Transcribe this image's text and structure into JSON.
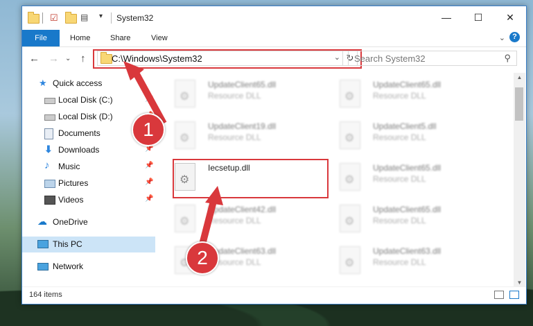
{
  "window": {
    "title": "System32",
    "controls": {
      "minimize": "—",
      "maximize": "☐",
      "close": "✕"
    }
  },
  "ribbon": {
    "tabs": [
      "File",
      "Home",
      "Share",
      "View"
    ],
    "expand_glyph": "⌄",
    "help_glyph": "?"
  },
  "nav": {
    "back": "←",
    "forward": "→",
    "recent": "⌄",
    "up": "↑",
    "address": "C:\\Windows\\System32",
    "address_dropdown": "⌄",
    "refresh": "↻",
    "search_placeholder": "Search System32",
    "search_icon": "⚲"
  },
  "sidebar": {
    "items": [
      {
        "label": "Quick access",
        "icon": "star-icon",
        "pinned": false
      },
      {
        "label": "Local Disk (C:)",
        "icon": "drive-icon",
        "pinned": true
      },
      {
        "label": "Local Disk (D:)",
        "icon": "drive-icon",
        "pinned": true
      },
      {
        "label": "Documents",
        "icon": "documents-icon",
        "pinned": true
      },
      {
        "label": "Downloads",
        "icon": "download-icon",
        "pinned": true
      },
      {
        "label": "Music",
        "icon": "music-icon",
        "pinned": true
      },
      {
        "label": "Pictures",
        "icon": "pictures-icon",
        "pinned": true
      },
      {
        "label": "Videos",
        "icon": "videos-icon",
        "pinned": true
      },
      {
        "label": "OneDrive",
        "icon": "cloud-icon",
        "pinned": false
      },
      {
        "label": "This PC",
        "icon": "pc-icon",
        "pinned": false,
        "selected": true
      },
      {
        "label": "Network",
        "icon": "network-icon",
        "pinned": false
      }
    ],
    "pin_glyph": "📌"
  },
  "files": [
    {
      "name": "UpdateClient65.dll",
      "type": "Resource DLL",
      "blurred": true
    },
    {
      "name": "UpdateClient65.dll",
      "type": "Resource DLL",
      "blurred": true
    },
    {
      "name": "UpdateClient19.dll",
      "type": "Resource DLL",
      "blurred": true
    },
    {
      "name": "UpdateClient5.dll",
      "type": "Resource DLL",
      "blurred": true
    },
    {
      "name": "Iecsetup.dll",
      "type": "",
      "blurred": false
    },
    {
      "name": "UpdateClient65.dll",
      "type": "Resource DLL",
      "blurred": true
    },
    {
      "name": "UpdateClient42.dll",
      "type": "Resource DLL",
      "blurred": true
    },
    {
      "name": "UpdateClient65.dll",
      "type": "Resource DLL",
      "blurred": true
    },
    {
      "name": "UpdateClient63.dll",
      "type": "Resource DLL",
      "blurred": true
    },
    {
      "name": "UpdateClient63.dll",
      "type": "Resource DLL",
      "blurred": true
    }
  ],
  "status": {
    "item_count": "164 items"
  },
  "annotations": {
    "step1": "1",
    "step2": "2",
    "accent": "#d9383c"
  }
}
